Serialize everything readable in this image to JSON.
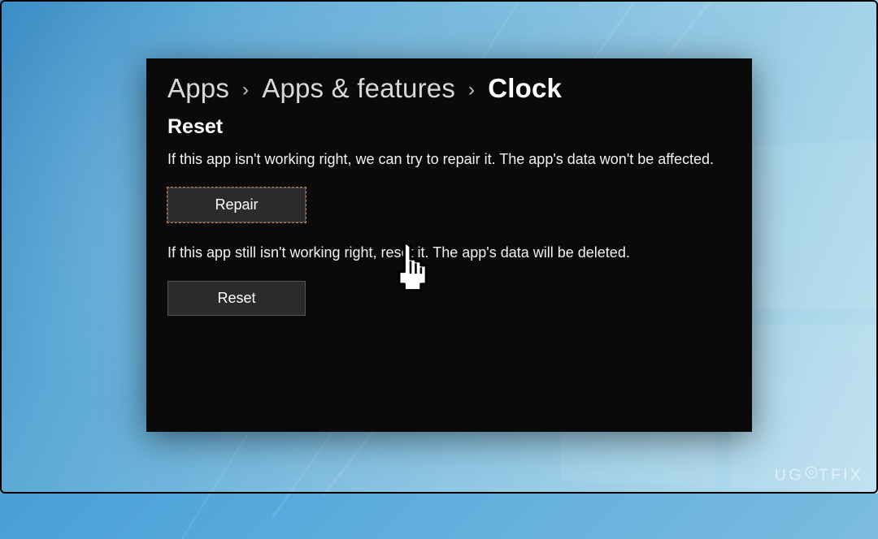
{
  "breadcrumb": {
    "level1": "Apps",
    "level2": "Apps & features",
    "current": "Clock"
  },
  "section": {
    "title": "Reset",
    "repair_desc": "If this app isn't working right, we can try to repair it. The app's data won't be affected.",
    "repair_button": "Repair",
    "reset_desc": "If this app still isn't working right, reset it. The app's data will be deleted.",
    "reset_button": "Reset"
  },
  "watermark": {
    "text_pre": "UG",
    "text_post": "TFIX"
  }
}
